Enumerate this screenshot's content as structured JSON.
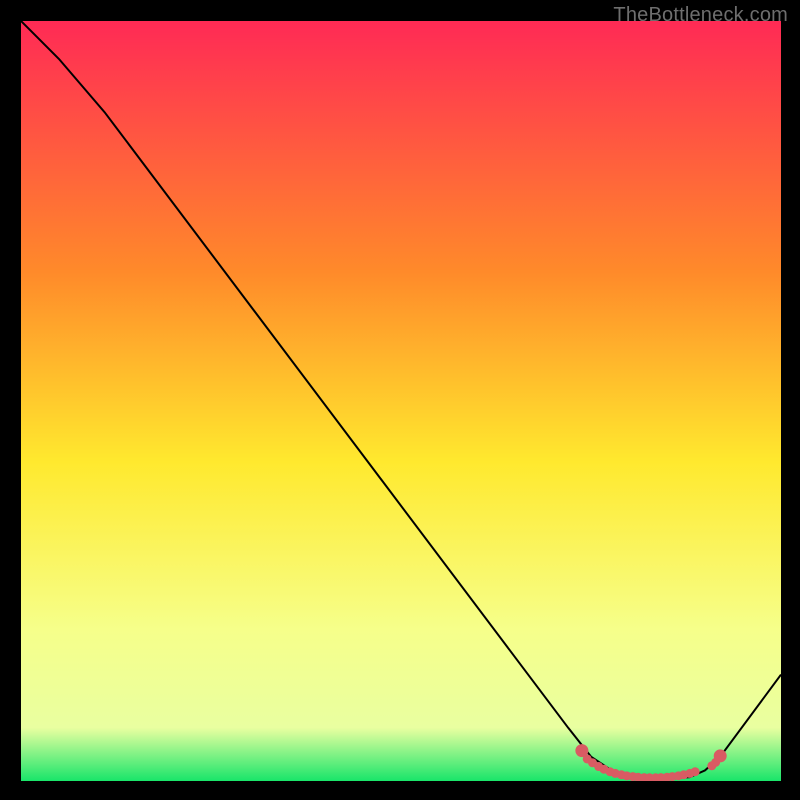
{
  "watermark": "TheBottleneck.com",
  "colors": {
    "bg": "#000000",
    "curve": "#000000",
    "marker": "#d95b63",
    "grad_top": "#ff2a55",
    "grad_mid_upper": "#ff8a2a",
    "grad_mid": "#ffe92e",
    "grad_mid_lower": "#f6ff8a",
    "grad_low": "#e9ffa0",
    "grad_bottom": "#19e56a"
  },
  "chart_data": {
    "type": "line",
    "title": "",
    "xlabel": "",
    "ylabel": "",
    "xlim": [
      0,
      100
    ],
    "ylim": [
      0,
      100
    ],
    "curve": [
      {
        "x": 0,
        "y": 100
      },
      {
        "x": 2,
        "y": 98
      },
      {
        "x": 5,
        "y": 95
      },
      {
        "x": 8,
        "y": 91.5
      },
      {
        "x": 11,
        "y": 88
      },
      {
        "x": 72,
        "y": 7
      },
      {
        "x": 75,
        "y": 3.2
      },
      {
        "x": 78,
        "y": 1.2
      },
      {
        "x": 80,
        "y": 0.5
      },
      {
        "x": 84,
        "y": 0.2
      },
      {
        "x": 88,
        "y": 0.5
      },
      {
        "x": 90,
        "y": 1.4
      },
      {
        "x": 92,
        "y": 3.2
      },
      {
        "x": 100,
        "y": 14
      }
    ],
    "markers_valley": [
      {
        "x": 74.5,
        "y": 2.9
      },
      {
        "x": 75.2,
        "y": 2.4
      },
      {
        "x": 76.0,
        "y": 1.9
      },
      {
        "x": 76.7,
        "y": 1.55
      },
      {
        "x": 77.5,
        "y": 1.22
      },
      {
        "x": 78.2,
        "y": 1.0
      },
      {
        "x": 79.0,
        "y": 0.82
      },
      {
        "x": 79.7,
        "y": 0.68
      },
      {
        "x": 80.5,
        "y": 0.58
      },
      {
        "x": 81.2,
        "y": 0.5
      },
      {
        "x": 82.0,
        "y": 0.45
      },
      {
        "x": 82.7,
        "y": 0.42
      },
      {
        "x": 83.5,
        "y": 0.42
      },
      {
        "x": 84.2,
        "y": 0.45
      },
      {
        "x": 85.0,
        "y": 0.5
      },
      {
        "x": 85.7,
        "y": 0.58
      },
      {
        "x": 86.5,
        "y": 0.68
      },
      {
        "x": 87.2,
        "y": 0.82
      },
      {
        "x": 88.0,
        "y": 1.0
      },
      {
        "x": 88.7,
        "y": 1.22
      }
    ],
    "markers_rise_small": [
      {
        "x": 90.9,
        "y": 2.0
      },
      {
        "x": 91.4,
        "y": 2.45
      }
    ],
    "markers_rise_large": [
      {
        "x": 73.8,
        "y": 4.0
      },
      {
        "x": 92.0,
        "y": 3.3
      }
    ]
  }
}
